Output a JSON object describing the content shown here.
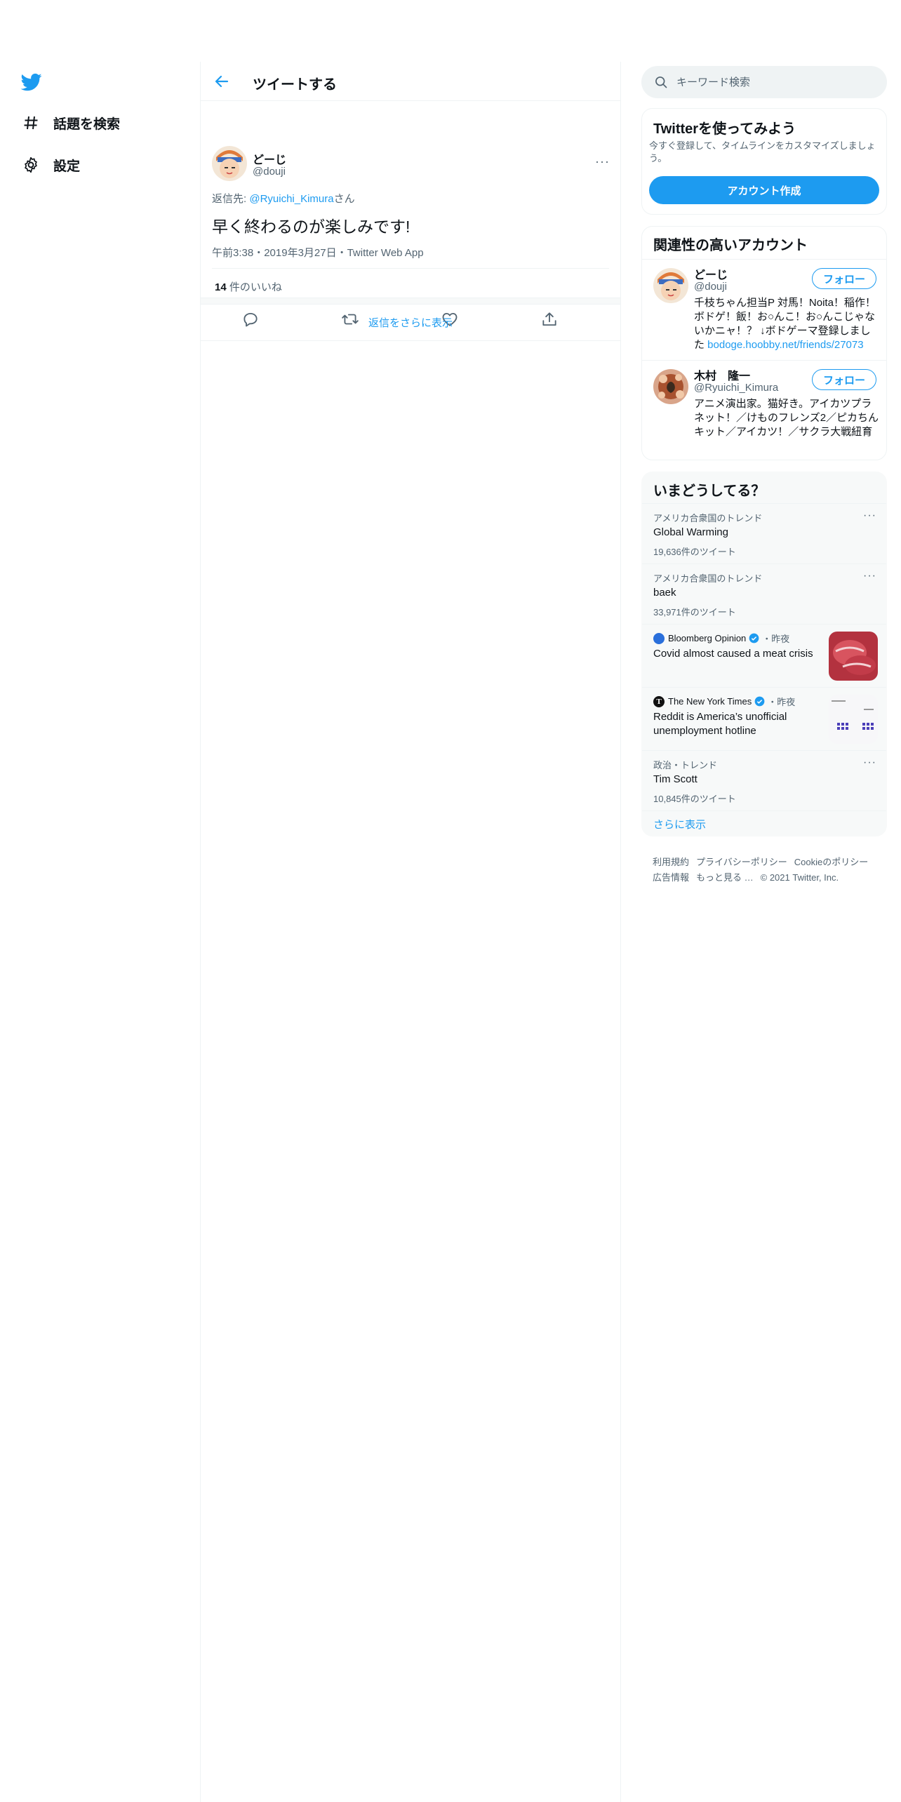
{
  "nav": {
    "explore_label": "話題を検索",
    "settings_label": "設定"
  },
  "header": {
    "title": "ツイートする"
  },
  "tweet": {
    "name": "どーじ",
    "handle": "@douji",
    "reply_prefix": "返信先: ",
    "reply_to": "@Ryuichi_Kimura",
    "reply_suffix": "さん",
    "text": "早く終わるのが楽しみです!",
    "meta": "午前3:38・2019年3月27日・Twitter Web App",
    "likes_count": "14",
    "likes_label": " 件のいいね",
    "show_more_replies": "返信をさらに表示"
  },
  "search": {
    "placeholder": "キーワード検索"
  },
  "signup": {
    "title": "Twitterを使ってみよう",
    "desc": "今すぐ登録して、タイムラインをカスタマイズしましょう。",
    "button": "アカウント作成"
  },
  "related": {
    "title": "関連性の高いアカウント",
    "accounts": [
      {
        "name": "どーじ",
        "handle": "@douji",
        "follow": "フォロー",
        "bio": "千枝ちゃん担当P 対馬！Noita！稲作！ボドゲ！飯！お○んこ！お○んこじゃないかニャ！？ ↓ボドゲーマ登録しました ",
        "bio_link": "bodoge.hoobby.net/friends/27073"
      },
      {
        "name": "木村　隆一",
        "handle": "@Ryuichi_Kimura",
        "follow": "フォロー",
        "bio": "アニメ演出家。猫好き。アイカツプラネット！／けものフレンズ2／ピカちんキット／アイカツ！／サクラ大戦紐育",
        "bio_link": ""
      }
    ]
  },
  "trends": {
    "title": "いまどうしてる？",
    "items": [
      {
        "context": "アメリカ合衆国のトレンド",
        "name": "Global Warming",
        "count": "19,636件のツイート"
      },
      {
        "context": "アメリカ合衆国のトレンド",
        "name": "baek",
        "count": "33,971件のツイート"
      },
      {
        "source": "Bloomberg Opinion",
        "time": "・昨夜",
        "title": "Covid almost caused a meat crisis"
      },
      {
        "source": "The New York Times",
        "time": "・昨夜",
        "title": "Reddit is America’s unofficial unemployment hotline"
      },
      {
        "context": "政治・トレンド",
        "name": "Tim Scott",
        "count": "10,845件のツイート"
      }
    ],
    "show_more": "さらに表示"
  },
  "footer": {
    "links": [
      "利用規約",
      "プライバシーポリシー",
      "Cookieのポリシー",
      "広告情報",
      "もっと見る …",
      "© 2021 Twitter, Inc."
    ]
  },
  "colors": {
    "accent": "#1d9bf0",
    "text": "#0f1419",
    "muted": "#536471",
    "border": "#eff3f4"
  }
}
